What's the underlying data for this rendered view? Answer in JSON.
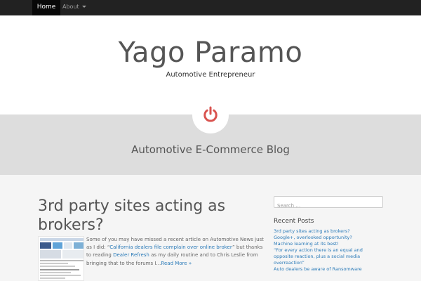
{
  "nav": {
    "home_label": "Home",
    "about_label": "About"
  },
  "header": {
    "site_title": "Yago Paramo",
    "tagline": "Automotive Entrepreneur"
  },
  "band": {
    "title": "Automotive E-Commerce Blog",
    "icon": "power-icon",
    "icon_color": "#d9534f"
  },
  "post": {
    "title": "3rd party sites acting as brokers?",
    "excerpt_part1": "Some of you may have missed a recent article on Automotive News just as I did: “",
    "excerpt_link1": "California dealers file complain over online broker",
    "excerpt_part2": "” but thanks to reading ",
    "excerpt_link2": "Dealer Refresh",
    "excerpt_part3": " as my daily routine and to Chris Leslie from bringing that to the forums I…",
    "read_more": "Read More »"
  },
  "sidebar": {
    "search_placeholder": "Search …",
    "recent_title": "Recent Posts",
    "recent_posts": [
      "3rd party sites acting as brokers?",
      "Google+, overlooked opportunity?",
      "Machine learning at its best!",
      "“For every action there is an equal and opposite reaction, plus a social media overreaction”",
      "Auto dealers be aware of Ransomware"
    ]
  },
  "colors": {
    "navbar": "#222222",
    "link": "#2a7ab8",
    "band": "#dddddd"
  }
}
